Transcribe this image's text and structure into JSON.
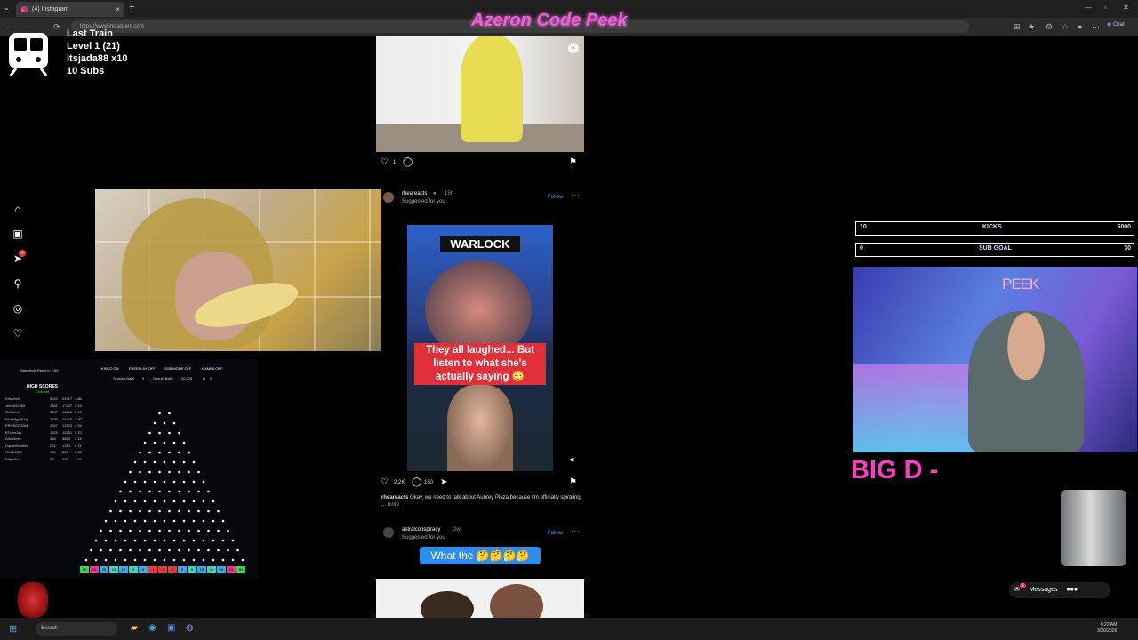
{
  "browser": {
    "tab_title": "(4) Instagram",
    "tab_close": "×",
    "new_tab": "+",
    "url": "https://www.instagram.com",
    "chat_label": "Chat"
  },
  "overlay": {
    "stream_title": "Azeron Code Peek",
    "train": {
      "line1": "Last Train",
      "line2": "Level 1  (21)",
      "line3": "itsjada88 x10",
      "line4": "10 Subs"
    },
    "kicks_bar": {
      "left": "10",
      "label": "KICKS",
      "right": "5000"
    },
    "subgoal_bar": {
      "left": "0",
      "label": "SUB GOAL",
      "right": "30"
    },
    "peek_label": "PEEK",
    "big_d": "BIG D -"
  },
  "plinko": {
    "reset_text": "Watchtime Reset in 2:55",
    "modes": [
      "KINKO ON",
      "FREEPLAY OFF",
      "SUB MODE OFF",
      "GAMBA OFF"
    ],
    "session_balls_label": "Session Balls",
    "session_balls": "0",
    "overall_balls_label": "Overall Balls",
    "overall_balls": "20,276",
    "q_label": "Q",
    "q_value": "0",
    "high_scores_title": "HIGH SCORES",
    "channel_label": "Channel",
    "scores": [
      {
        "name": "KrisVeeth",
        "a": "5022",
        "b": "24417",
        "c": "4.86"
      },
      {
        "name": "Jerry051982",
        "a": "3381",
        "b": "17427",
        "c": "5.15"
      },
      {
        "name": "SuGaLaY",
        "a": "3237",
        "b": "16766",
        "c": "5.18"
      },
      {
        "name": "BluetidghtKing",
        "a": "2785",
        "b": "14478",
        "c": "5.20"
      },
      {
        "name": "PROSCR3AM",
        "a": "2657",
        "b": "13133",
        "c": "4.94"
      },
      {
        "name": "BTownJoy",
        "a": "1925",
        "b": "10251",
        "c": "5.33"
      },
      {
        "name": "Arkoldees",
        "a": "458",
        "b": "5869",
        "c": "4.15"
      },
      {
        "name": "GameShooter",
        "a": "221",
        "b": "1350",
        "c": "6.11"
      },
      {
        "name": "SHLBMEE",
        "a": "160",
        "b": "813",
        "c": "5.08"
      },
      {
        "name": "StreicFox",
        "a": "90",
        "b": "409",
        "c": "4.54"
      }
    ],
    "slots": [
      {
        "v": "50",
        "color": "#3fd44a"
      },
      {
        "v": "10",
        "color": "#e43b8c"
      },
      {
        "v": "25",
        "color": "#3fa8e0"
      },
      {
        "v": "10",
        "color": "#3fd4b8"
      },
      {
        "v": "10",
        "color": "#3fa8e0"
      },
      {
        "v": "5",
        "color": "#3fd4b8"
      },
      {
        "v": "5",
        "color": "#3fa8e0"
      },
      {
        "v": "-1",
        "color": "#e43b3b"
      },
      {
        "v": "-2",
        "color": "#e43b3b"
      },
      {
        "v": "-1",
        "color": "#e43b3b"
      },
      {
        "v": "5",
        "color": "#3fa8e0"
      },
      {
        "v": "5",
        "color": "#3fd4b8"
      },
      {
        "v": "10",
        "color": "#3fa8e0"
      },
      {
        "v": "10",
        "color": "#3fd4b8"
      },
      {
        "v": "25",
        "color": "#3fa8e0"
      },
      {
        "v": "10",
        "color": "#e43b8c"
      },
      {
        "v": "50",
        "color": "#3fd44a"
      }
    ]
  },
  "feed": {
    "post1": {
      "likes": "1"
    },
    "post2": {
      "username": "rheareacts",
      "time": "15h",
      "suggested": "Suggested for you",
      "follow": "Follow",
      "overlay_label": "WARLOCK",
      "caption_line1": "They all laughed... But",
      "caption_line2": "listen to what she's",
      "caption_line3": "actually saying 😳",
      "likes": "2.2K",
      "comments": "150",
      "text_user": "rheareacts",
      "text": "Okay, we need to talk about Aubrey Plaza because I'm officially spiraling. ...",
      "more": "more"
    },
    "post3": {
      "username": "astralconspiracy",
      "time": "2w",
      "suggested": "Suggested for you",
      "follow": "Follow",
      "banner": "What the 🤔🤔🤔🤔"
    }
  },
  "sidebar": {
    "icons": [
      "home-icon",
      "reels-icon",
      "send-icon",
      "search-icon",
      "explore-icon",
      "heart-icon"
    ],
    "notification_count": "4"
  },
  "messages": {
    "label": "Messages",
    "count": "4"
  },
  "taskbar": {
    "search_placeholder": "Search",
    "time": "6:22 AM",
    "date": "3/30/2026"
  },
  "colors": {
    "accent_pink": "#ff3cc8",
    "instagram_blue": "#4aa3ff",
    "caption_red": "#e2303b"
  }
}
